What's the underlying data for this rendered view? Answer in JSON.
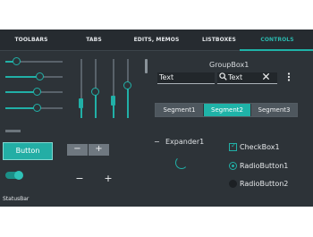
{
  "tabs": [
    {
      "label": "TOOLBARS",
      "active": false
    },
    {
      "label": "TABS",
      "active": false
    },
    {
      "label": "EDITS, MEMOS",
      "active": false
    },
    {
      "label": "LISTBOXES",
      "active": false
    },
    {
      "label": "CONTROLS",
      "active": true
    }
  ],
  "colors": {
    "accent": "#21b0a7",
    "background": "#2d3338",
    "tabbar": "#262b30"
  },
  "sliders": {
    "horizontal_levels": [
      0.2,
      0.6,
      0.55,
      0.55
    ],
    "vertical_levels": [
      0.25,
      0.45,
      0.3,
      0.55
    ]
  },
  "accent_button": {
    "label": "Button"
  },
  "stepper": {
    "minus": "−",
    "plus": "+"
  },
  "plain_buttons": {
    "minus": "−",
    "plus": "+"
  },
  "toggle": {
    "on": true
  },
  "statusbar": {
    "text": "StatusBar"
  },
  "groupbox": {
    "title": "GroupBox1",
    "edit1": {
      "value": "Text"
    },
    "edit2": {
      "value": "Text",
      "search_icon": "search-icon",
      "clear_icon": "close-icon"
    },
    "more_icon": "more-vertical-icon"
  },
  "segments": [
    {
      "label": "Segment1",
      "active": false
    },
    {
      "label": "Segment2",
      "active": true
    },
    {
      "label": "Segment3",
      "active": false
    }
  ],
  "expander": {
    "symbol": "−",
    "label": "Expander1"
  },
  "checkbox": {
    "label": "CheckBox1",
    "checked": true,
    "mark": "✓"
  },
  "radios": [
    {
      "label": "RadioButton1",
      "selected": true
    },
    {
      "label": "RadioButton2",
      "selected": false
    }
  ]
}
